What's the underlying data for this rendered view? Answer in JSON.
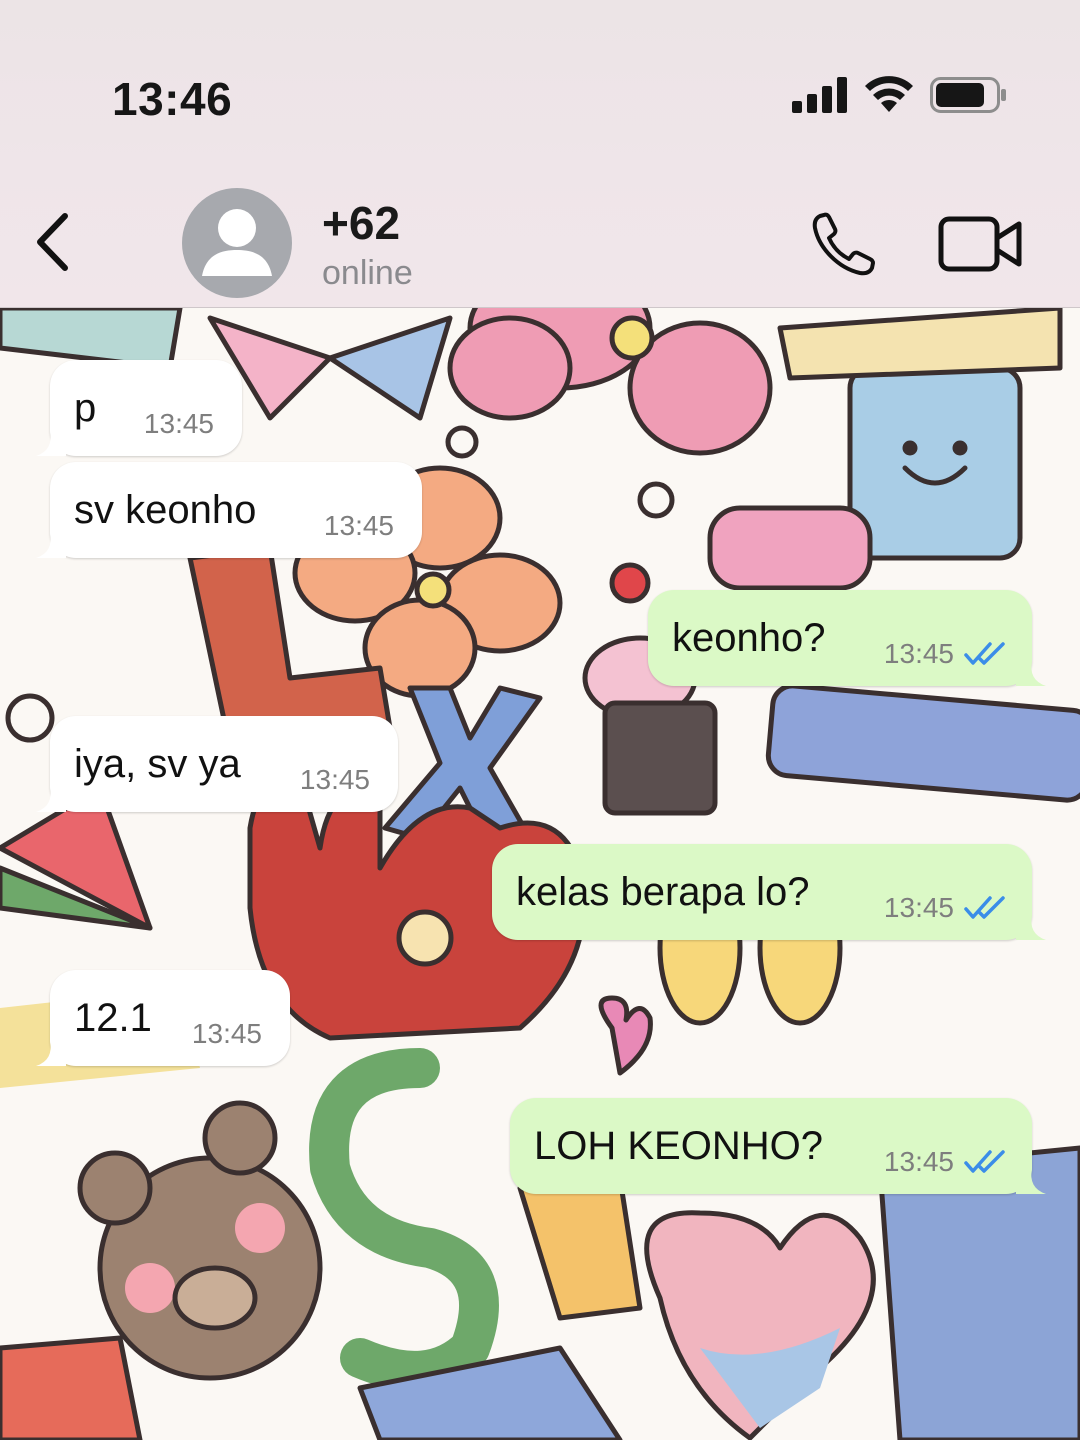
{
  "status_bar": {
    "time": "13:46"
  },
  "header": {
    "contact_name": "+62",
    "contact_status": "online"
  },
  "messages": [
    {
      "direction": "incoming",
      "text": "p",
      "time": "13:45"
    },
    {
      "direction": "incoming",
      "text": "sv keonho",
      "time": "13:45"
    },
    {
      "direction": "outgoing",
      "text": "keonho?",
      "time": "13:45",
      "status": "read"
    },
    {
      "direction": "incoming",
      "text": "iya, sv ya",
      "time": "13:45"
    },
    {
      "direction": "outgoing",
      "text": "kelas berapa lo?",
      "time": "13:45",
      "status": "read"
    },
    {
      "direction": "incoming",
      "text": "12.1",
      "time": "13:45"
    },
    {
      "direction": "outgoing",
      "text": "LOH KEONHO?",
      "time": "13:45",
      "status": "read"
    }
  ],
  "colors": {
    "outgoing_bubble": "#dbf9c6",
    "incoming_bubble": "#ffffff",
    "read_ticks": "#3b8de8"
  }
}
